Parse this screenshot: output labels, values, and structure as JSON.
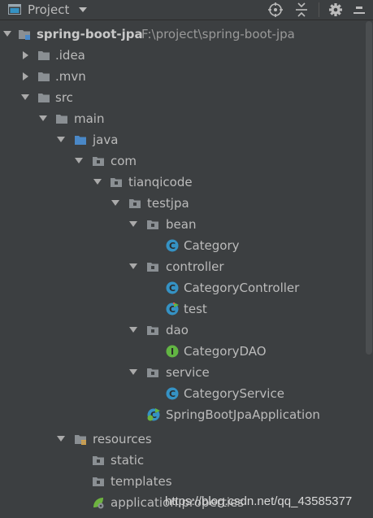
{
  "toolbar": {
    "title": "Project",
    "icons": [
      "project-view-icon",
      "chevron-down-icon",
      "locate-icon",
      "collapse-all-icon",
      "gear-icon",
      "hide-icon"
    ]
  },
  "colors": {
    "background": "#3c3f41",
    "folder": "#8a8f93",
    "source_folder": "#4a88c7",
    "class_icon": "#3592c4",
    "interface_icon": "#62b543",
    "spring_icon": "#6db33f"
  },
  "tree": {
    "root": {
      "label": "spring-boot-jpa",
      "path": "F:\\project\\spring-boot-jpa"
    },
    "idea": {
      "label": ".idea"
    },
    "mvn": {
      "label": ".mvn"
    },
    "src": {
      "label": "src"
    },
    "main": {
      "label": "main"
    },
    "java": {
      "label": "java"
    },
    "com": {
      "label": "com"
    },
    "tianqicode": {
      "label": "tianqicode"
    },
    "testjpa": {
      "label": "testjpa"
    },
    "bean": {
      "label": "bean"
    },
    "category": {
      "label": "Category"
    },
    "controller": {
      "label": "controller"
    },
    "category_controller": {
      "label": "CategoryController"
    },
    "test": {
      "label": "test"
    },
    "dao": {
      "label": "dao"
    },
    "category_dao": {
      "label": "CategoryDAO"
    },
    "service": {
      "label": "service"
    },
    "category_service": {
      "label": "CategoryService"
    },
    "app": {
      "label": "SpringBootJpaApplication"
    },
    "resources": {
      "label": "resources"
    },
    "static": {
      "label": "static"
    },
    "templates": {
      "label": "templates"
    },
    "properties": {
      "label": "application.properties"
    }
  },
  "watermark": "https://blog.csdn.net/qq_43585377"
}
